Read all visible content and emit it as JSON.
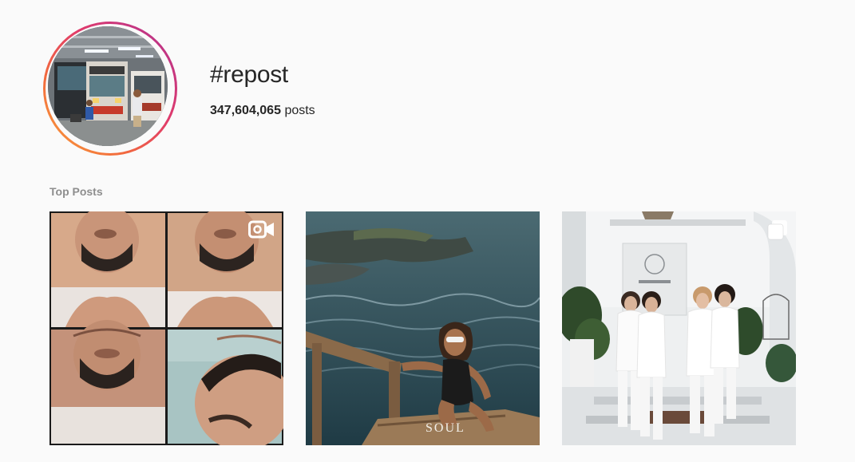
{
  "header": {
    "hashtag": "#repost",
    "post_count": "347,604,065",
    "post_count_suffix": "posts"
  },
  "sections": {
    "top_posts_label": "Top Posts"
  },
  "top_posts": [
    {
      "type": "igtv-video",
      "badge_icon": "igtv-icon"
    },
    {
      "type": "photo",
      "watermark": "SOUL"
    },
    {
      "type": "carousel",
      "badge_icon": "carousel-icon"
    }
  ],
  "colors": {
    "background": "#fafafa",
    "text": "#262626",
    "secondary_text": "#8e8e8e",
    "ring_gradient": [
      "#f9a43a",
      "#f26a3d",
      "#e03b6b",
      "#c13584",
      "#a433b3"
    ]
  }
}
